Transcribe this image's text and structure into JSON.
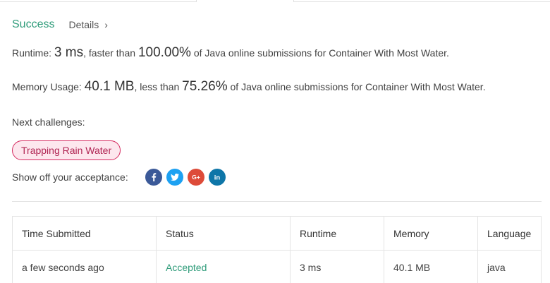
{
  "header": {
    "status": "Success",
    "details_label": "Details",
    "details_chevron": "›"
  },
  "runtime": {
    "label": "Runtime: ",
    "value": "3 ms",
    "middle": ", faster than ",
    "percent": "100.00%",
    "suffix": " of Java online submissions for Container With Most Water."
  },
  "memory": {
    "label": "Memory Usage: ",
    "value": "40.1 MB",
    "middle": ", less than ",
    "percent": "75.26%",
    "suffix": " of Java online submissions for Container With Most Water."
  },
  "next_challenges": {
    "label": "Next challenges:",
    "items": [
      {
        "label": "Trapping Rain Water"
      }
    ]
  },
  "share": {
    "label": "Show off your acceptance:",
    "icons": [
      {
        "name": "facebook-icon",
        "glyph": "f",
        "color": "#3b5998"
      },
      {
        "name": "twitter-icon",
        "glyph": "",
        "color": "#1da1f2"
      },
      {
        "name": "google-plus-icon",
        "glyph": "G+",
        "color": "#dd4b39"
      },
      {
        "name": "linkedin-icon",
        "glyph": "in",
        "color": "#0e76a8"
      }
    ]
  },
  "table": {
    "columns": [
      "Time Submitted",
      "Status",
      "Runtime",
      "Memory",
      "Language"
    ],
    "rows": [
      [
        "a few seconds ago",
        "Accepted",
        "3 ms",
        "40.1 MB",
        "java"
      ]
    ]
  },
  "colors": {
    "accent": "#2f9c7a",
    "pill_border": "#d52a5f",
    "pill_bg": "#fde7ee"
  }
}
